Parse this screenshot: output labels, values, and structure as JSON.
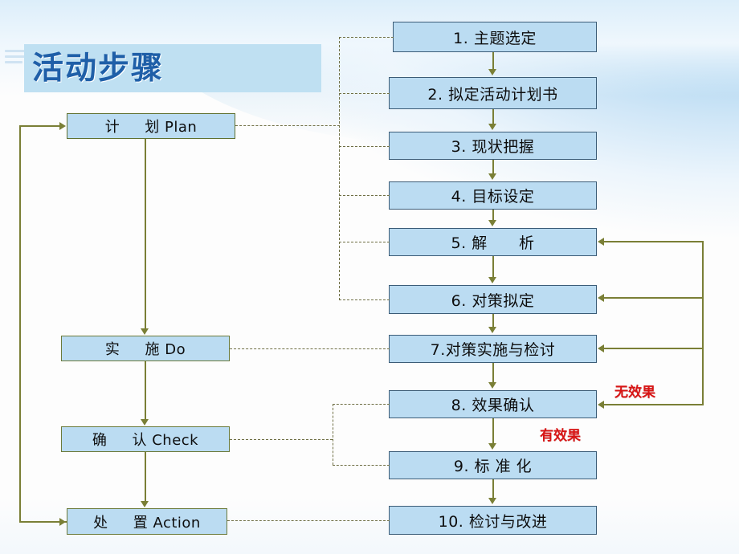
{
  "slide": {
    "title": "活动步骤",
    "decor_icon": "stripes-icon"
  },
  "colors": {
    "box_fill": "#bbdcf2",
    "box_border": "#3b5c77",
    "pdca_border": "#6b7a3a",
    "title_band": "#bfe0f2",
    "title_text": "#1f5fa8",
    "connector": "#7a7f36",
    "dashed_connector": "#6f6f45",
    "annotation_red": "#d81414"
  },
  "pdca_cycle": [
    {
      "id": "plan",
      "label": "计     划 Plan"
    },
    {
      "id": "do",
      "label": "实     施 Do"
    },
    {
      "id": "check",
      "label": "确     认 Check"
    },
    {
      "id": "action",
      "label": "处     置 Action"
    }
  ],
  "steps": [
    {
      "no": "1",
      "label": "1. 主题选定"
    },
    {
      "no": "2",
      "label": "2. 拟定活动计划书"
    },
    {
      "no": "3",
      "label": "3. 现状把握"
    },
    {
      "no": "4",
      "label": "4. 目标设定"
    },
    {
      "no": "5",
      "label": "5. 解      析"
    },
    {
      "no": "6",
      "label": "6. 对策拟定"
    },
    {
      "no": "7",
      "label": "7.对策实施与检讨"
    },
    {
      "no": "8",
      "label": "8. 效果确认"
    },
    {
      "no": "9",
      "label": "9. 标 准 化"
    },
    {
      "no": "10",
      "label": "10. 检讨与改进"
    }
  ],
  "annotations": {
    "no_effect": "无效果",
    "has_effect": "有效果"
  },
  "chart_data": {
    "type": "diagram",
    "title": "活动步骤",
    "diagram_kind": "PDCA flowchart",
    "left_column": [
      "计     划 Plan",
      "实     施 Do",
      "确     认 Check",
      "处     置 Action"
    ],
    "right_column": [
      "1. 主题选定",
      "2. 拟定活动计划书",
      "3. 现状把握",
      "4. 目标设定",
      "5. 解      析",
      "6. 对策拟定",
      "7.对策实施与检讨",
      "8. 效果确认",
      "9. 标 准 化",
      "10. 检讨与改进"
    ],
    "mapping": {
      "Plan": [
        "1",
        "2",
        "3",
        "4",
        "5",
        "6"
      ],
      "Do": [
        "7"
      ],
      "Check": [
        "8",
        "9"
      ],
      "Action": [
        "10"
      ]
    },
    "feedback_loops": [
      {
        "from": "8. 效果确认",
        "to": [
          "5. 解      析",
          "6. 对策拟定",
          "7.对策实施与检讨"
        ],
        "condition": "无效果"
      },
      {
        "from": "8. 效果确认",
        "to": [
          "9. 标 准 化"
        ],
        "condition": "有效果"
      },
      {
        "from": "处     置 Action",
        "to": [
          "计     划 Plan"
        ],
        "condition": ""
      }
    ]
  }
}
